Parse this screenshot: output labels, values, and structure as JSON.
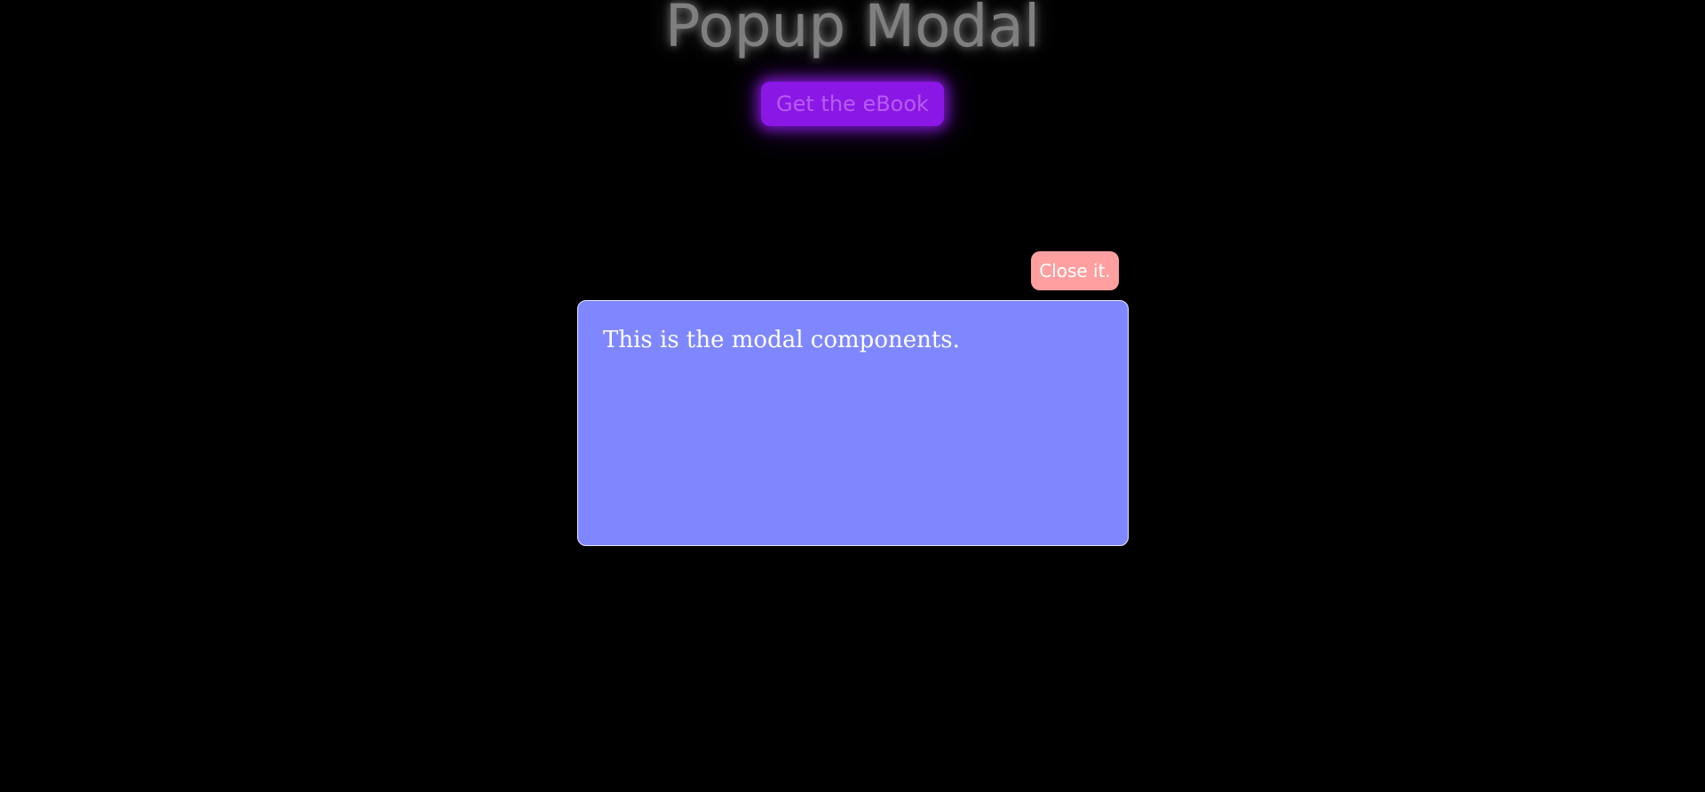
{
  "header": {
    "title": "Popup Modal",
    "cta_label": "Get the eBook"
  },
  "modal": {
    "close_label": "Close it.",
    "body_text": "This is the modal components."
  },
  "colors": {
    "background": "#000000",
    "title": "#7f7f7f",
    "cta_background": "#8a17e6",
    "cta_text": "#b75cf2",
    "close_background": "#ff9f9f",
    "modal_background": "#7f87ff",
    "modal_text": "#ffffff"
  }
}
